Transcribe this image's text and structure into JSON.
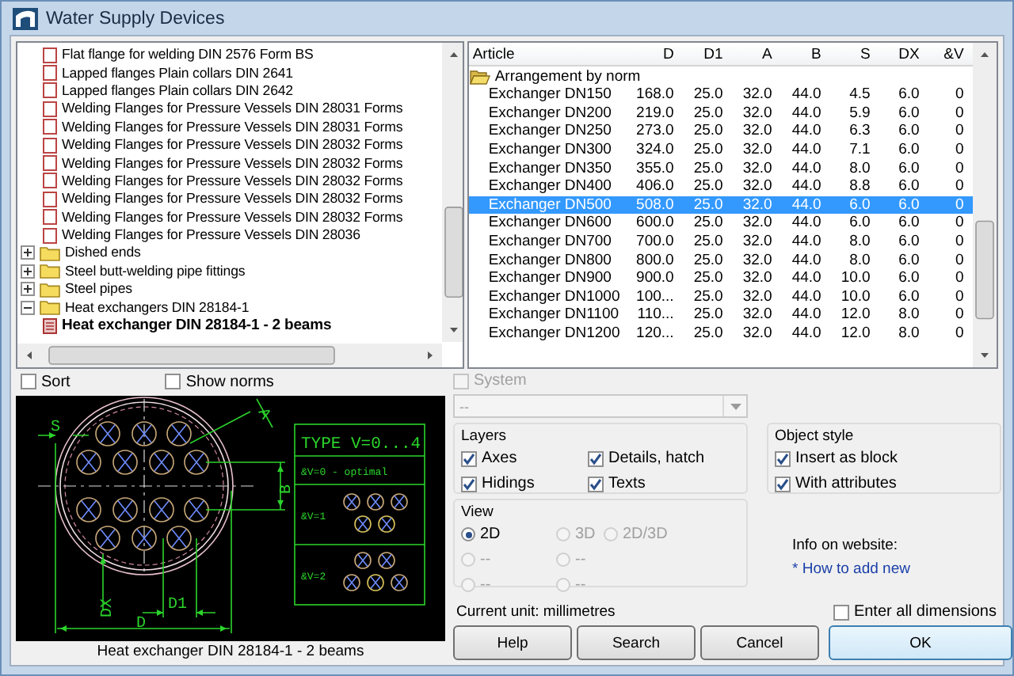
{
  "window": {
    "title": "Water Supply Devices"
  },
  "tree": {
    "items": [
      {
        "children": [
          {
            "label": "Flat flange for welding DIN 2576 Form BS",
            "kind": "part",
            "selected": false
          },
          {
            "label": "Lapped flanges Plain collars DIN 2641",
            "kind": "part",
            "selected": false
          },
          {
            "label": "Lapped flanges Plain collars DIN 2642",
            "kind": "part",
            "selected": false
          },
          {
            "label": "Welding Flanges for Pressure Vessels DIN 28031 Forms",
            "kind": "part",
            "selected": false
          },
          {
            "label": "Welding Flanges for Pressure Vessels DIN 28031 Forms",
            "kind": "part",
            "selected": false
          },
          {
            "label": "Welding Flanges for Pressure Vessels DIN 28032 Forms",
            "kind": "part",
            "selected": false
          },
          {
            "label": "Welding Flanges for Pressure Vessels DIN 28032 Forms",
            "kind": "part",
            "selected": false
          },
          {
            "label": "Welding Flanges for Pressure Vessels DIN 28032 Forms",
            "kind": "part",
            "selected": false
          },
          {
            "label": "Welding Flanges for Pressure Vessels DIN 28032 Forms",
            "kind": "part",
            "selected": false
          },
          {
            "label": "Welding Flanges for Pressure Vessels DIN 28032 Forms",
            "kind": "part",
            "selected": false
          },
          {
            "label": "Welding Flanges for Pressure Vessels DIN 28036",
            "kind": "part",
            "selected": false
          }
        ]
      },
      {
        "label": "Dished ends",
        "kind": "folder",
        "expanded": false
      },
      {
        "label": "Steel butt-welding pipe fittings",
        "kind": "folder",
        "expanded": false
      },
      {
        "label": "Steel pipes",
        "kind": "folder",
        "expanded": false
      },
      {
        "label": "Heat exchangers DIN 28184-1",
        "kind": "folder",
        "expanded": true,
        "children": [
          {
            "label": "Heat exchanger DIN 28184-1 - 2 beams",
            "kind": "part",
            "selected": true
          }
        ]
      }
    ]
  },
  "table": {
    "columns": [
      "Article",
      "D",
      "D1",
      "A",
      "B",
      "S",
      "DX",
      "&V"
    ],
    "rows": [
      {
        "kind": "group",
        "label": "Arrangement by norm"
      },
      {
        "kind": "item",
        "selected": false,
        "cells": [
          "Exchanger DN150",
          "168.0",
          "25.0",
          "32.0",
          "44.0",
          "4.5",
          "6.0",
          "0"
        ]
      },
      {
        "kind": "item",
        "selected": false,
        "cells": [
          "Exchanger DN200",
          "219.0",
          "25.0",
          "32.0",
          "44.0",
          "5.9",
          "6.0",
          "0"
        ]
      },
      {
        "kind": "item",
        "selected": false,
        "cells": [
          "Exchanger DN250",
          "273.0",
          "25.0",
          "32.0",
          "44.0",
          "6.3",
          "6.0",
          "0"
        ]
      },
      {
        "kind": "item",
        "selected": false,
        "cells": [
          "Exchanger DN300",
          "324.0",
          "25.0",
          "32.0",
          "44.0",
          "7.1",
          "6.0",
          "0"
        ]
      },
      {
        "kind": "item",
        "selected": false,
        "cells": [
          "Exchanger DN350",
          "355.0",
          "25.0",
          "32.0",
          "44.0",
          "8.0",
          "6.0",
          "0"
        ]
      },
      {
        "kind": "item",
        "selected": false,
        "cells": [
          "Exchanger DN400",
          "406.0",
          "25.0",
          "32.0",
          "44.0",
          "8.8",
          "6.0",
          "0"
        ]
      },
      {
        "kind": "item",
        "selected": true,
        "cells": [
          "Exchanger DN500",
          "508.0",
          "25.0",
          "32.0",
          "44.0",
          "6.0",
          "6.0",
          "0"
        ]
      },
      {
        "kind": "item",
        "selected": false,
        "cells": [
          "Exchanger DN600",
          "600.0",
          "25.0",
          "32.0",
          "44.0",
          "6.0",
          "6.0",
          "0"
        ]
      },
      {
        "kind": "item",
        "selected": false,
        "cells": [
          "Exchanger DN700",
          "700.0",
          "25.0",
          "32.0",
          "44.0",
          "8.0",
          "6.0",
          "0"
        ]
      },
      {
        "kind": "item",
        "selected": false,
        "cells": [
          "Exchanger DN800",
          "800.0",
          "25.0",
          "32.0",
          "44.0",
          "8.0",
          "6.0",
          "0"
        ]
      },
      {
        "kind": "item",
        "selected": false,
        "cells": [
          "Exchanger DN900",
          "900.0",
          "25.0",
          "32.0",
          "44.0",
          "10.0",
          "6.0",
          "0"
        ]
      },
      {
        "kind": "item",
        "selected": false,
        "cells": [
          "Exchanger DN1000",
          "100...",
          "25.0",
          "32.0",
          "44.0",
          "10.0",
          "6.0",
          "0"
        ]
      },
      {
        "kind": "item",
        "selected": false,
        "cells": [
          "Exchanger DN1100",
          "110...",
          "25.0",
          "32.0",
          "44.0",
          "12.0",
          "8.0",
          "0"
        ]
      },
      {
        "kind": "item",
        "selected": false,
        "cells": [
          "Exchanger DN1200",
          "120...",
          "25.0",
          "32.0",
          "44.0",
          "12.0",
          "8.0",
          "0"
        ]
      }
    ]
  },
  "sort": {
    "label": "Sort",
    "checked": false
  },
  "show_norms": {
    "label": "Show norms",
    "checked": false
  },
  "preview": {
    "labels": {
      "s": "S",
      "a": "A",
      "b": "B",
      "dx": "DX",
      "d1": "D1",
      "d": "D"
    },
    "legend": {
      "title": "TYPE V=0...4",
      "rows": [
        "&V=0 - optimal",
        "&V=1",
        "&V=2"
      ]
    },
    "caption": "Heat exchanger DIN 28184-1 - 2 beams"
  },
  "system": {
    "label": "System",
    "checked": false,
    "disabled": true
  },
  "dropdown": {
    "value": "--",
    "disabled": true
  },
  "layers": {
    "title": "Layers",
    "options": [
      {
        "label": "Axes",
        "checked": true
      },
      {
        "label": "Details, hatch",
        "checked": true
      },
      {
        "label": "Hidings",
        "checked": true
      },
      {
        "label": "Texts",
        "checked": true
      }
    ]
  },
  "object_style": {
    "title": "Object style",
    "options": [
      {
        "label": "Insert as block",
        "checked": true
      },
      {
        "label": "With attributes",
        "checked": true
      }
    ]
  },
  "view": {
    "title": "View",
    "options": [
      {
        "label": "2D",
        "selected": true,
        "disabled": false
      },
      {
        "label": "3D",
        "selected": false,
        "disabled": true
      },
      {
        "label": "2D/3D",
        "selected": false,
        "disabled": true
      },
      {
        "label": "--",
        "selected": false,
        "disabled": true
      },
      {
        "label": "--",
        "selected": false,
        "disabled": true
      },
      {
        "label": "--",
        "selected": false,
        "disabled": true
      },
      {
        "label": "--",
        "selected": false,
        "disabled": true
      }
    ]
  },
  "info": {
    "label": "Info on website:",
    "link": "* How to add new"
  },
  "unit": "Current unit: millimetres",
  "enter_all": {
    "label": "Enter all dimensions",
    "checked": false
  },
  "buttons": [
    {
      "label": "Help",
      "default": false
    },
    {
      "label": "Search",
      "default": false
    },
    {
      "label": "Cancel",
      "default": false
    },
    {
      "label": "OK",
      "default": true
    }
  ]
}
